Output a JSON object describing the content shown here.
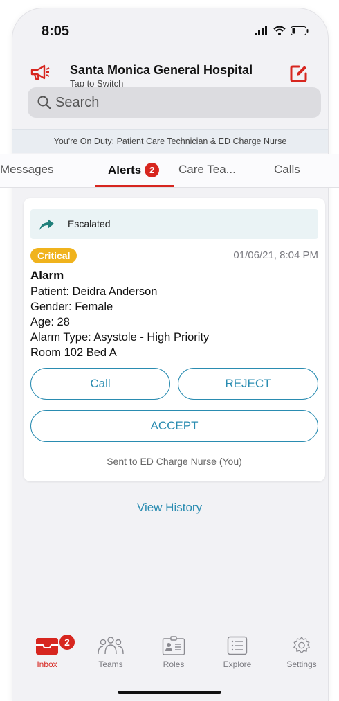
{
  "status_bar": {
    "time": "8:05"
  },
  "header": {
    "hospital_name": "Santa Monica General Hospital",
    "subtitle": "Tap to Switch"
  },
  "search": {
    "placeholder": "Search"
  },
  "duty_banner": "You're On Duty: Patient Care Technician & ED Charge Nurse",
  "tabs": [
    {
      "label": "Messages"
    },
    {
      "label": "Alerts",
      "badge": "2",
      "active": true
    },
    {
      "label": "Care Tea..."
    },
    {
      "label": "Calls"
    }
  ],
  "alert_card": {
    "escalation": "Escalated",
    "severity": "Critical",
    "timestamp": "01/06/21, 8:04 PM",
    "title": "Alarm",
    "details": [
      "Patient: Deidra Anderson",
      "Gender: Female",
      "Age: 28",
      "Alarm Type: Asystole - High Priority",
      "Room 102 Bed A"
    ],
    "call_label": "Call",
    "reject_label": "REJECT",
    "accept_label": "ACCEPT",
    "sent_to": "Sent to ED Charge Nurse (You)"
  },
  "view_history": "View History",
  "tab_bar": {
    "items": [
      {
        "label": "Inbox",
        "icon": "inbox-icon",
        "badge": "2",
        "active": true
      },
      {
        "label": "Teams",
        "icon": "teams-icon"
      },
      {
        "label": "Roles",
        "icon": "roles-icon"
      },
      {
        "label": "Explore",
        "icon": "explore-icon"
      },
      {
        "label": "Settings",
        "icon": "settings-icon"
      }
    ]
  },
  "colors": {
    "accent_red": "#d7261f",
    "link_blue": "#2a8cb1",
    "critical_yellow": "#f0b31d",
    "escalated_green": "#1f7f7a"
  }
}
